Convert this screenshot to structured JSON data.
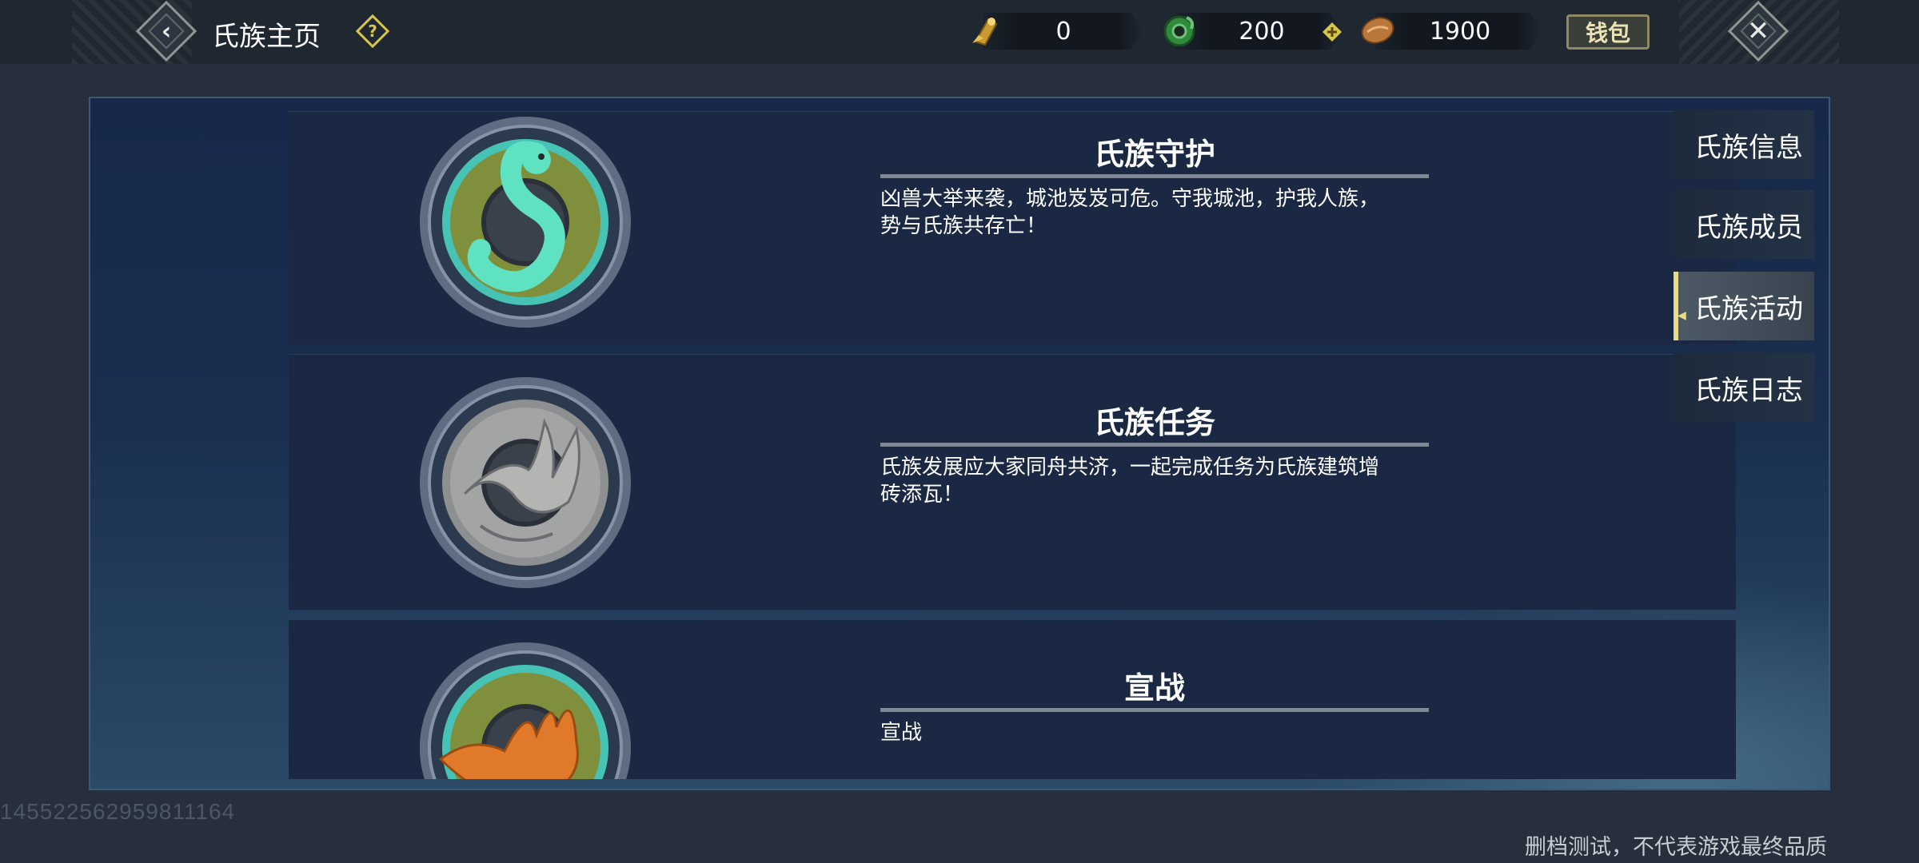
{
  "header": {
    "title": "氏族主页",
    "back_icon": "back-arrow-icon",
    "help_icon": "question-icon",
    "resources": [
      {
        "icon": "gold-scroll-icon",
        "value": "0"
      },
      {
        "icon": "jade-coin-icon",
        "value": "200"
      },
      {
        "icon": "copper-coin-icon",
        "value": "1900"
      }
    ],
    "add_icon": "plus-icon",
    "wallet_label": "钱包",
    "close_icon": "close-icon"
  },
  "cards": [
    {
      "title": "氏族守护",
      "desc_line1": "凶兽大举来袭，城池岌岌可危。守我城池，护我人族，",
      "desc_line2": "势与氏族共存亡！",
      "emblem": "snake-emblem-icon"
    },
    {
      "title": "氏族任务",
      "desc_line1": "氏族发展应大家同舟共济，一起完成任务为氏族建筑增",
      "desc_line2": "砖添瓦！",
      "emblem": "fox-emblem-icon"
    },
    {
      "title": "宣战",
      "desc_line1": "宣战",
      "desc_line2": "",
      "emblem": "fire-fox-emblem-icon"
    }
  ],
  "tabs": [
    {
      "label": "氏族信息",
      "active": false
    },
    {
      "label": "氏族成员",
      "active": false
    },
    {
      "label": "氏族活动",
      "active": true
    },
    {
      "label": "氏族日志",
      "active": false
    }
  ],
  "footer": {
    "user_id": "14552256295981 1164",
    "user_id_display": "14552256295981​1164",
    "disclaimer": "删档测试，不代表游戏最终品质"
  },
  "colors": {
    "accent_gold": "#d9c44a",
    "snake_teal": "#46d3b0",
    "emblem_olive": "#7f8f3c",
    "fire_orange": "#e07a2a"
  }
}
